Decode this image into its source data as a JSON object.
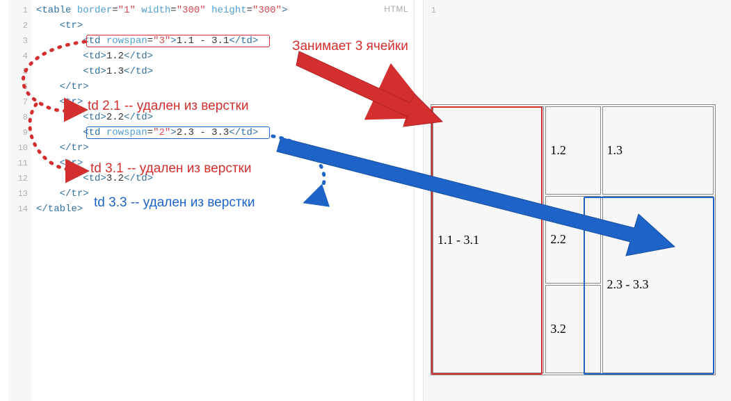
{
  "lang_badge": "HTML",
  "code": {
    "line_count": 14,
    "lines": [
      {
        "indent": 0,
        "html": "<span class='tok-tag'>&lt;table</span> <span class='tok-attr'>border</span>=<span class='tok-val'>\"1\"</span> <span class='tok-attr'>width</span>=<span class='tok-val'>\"300\"</span> <span class='tok-attr'>height</span>=<span class='tok-val'>\"300\"</span><span class='tok-tag'>&gt;</span>"
      },
      {
        "indent": 1,
        "html": "<span class='tok-tag'>&lt;tr&gt;</span>"
      },
      {
        "indent": 2,
        "html": "<span class='tok-tag'>&lt;td</span> <span class='tok-attr'>rowspan</span>=<span class='tok-val'>\"3\"</span><span class='tok-tag'>&gt;</span><span class='tok-txt'>1.1 - 3.1</span><span class='tok-tag'>&lt;/td&gt;</span>"
      },
      {
        "indent": 2,
        "html": "<span class='tok-tag'>&lt;td&gt;</span><span class='tok-txt'>1.2</span><span class='tok-tag'>&lt;/td&gt;</span>"
      },
      {
        "indent": 2,
        "html": "<span class='tok-tag'>&lt;td&gt;</span><span class='tok-txt'>1.3</span><span class='tok-tag'>&lt;/td&gt;</span>"
      },
      {
        "indent": 1,
        "html": "<span class='tok-tag'>&lt;/tr&gt;</span>"
      },
      {
        "indent": 1,
        "html": "<span class='tok-tag'>&lt;tr&gt;</span>"
      },
      {
        "indent": 2,
        "html": "<span class='tok-tag'>&lt;td&gt;</span><span class='tok-txt'>2.2</span><span class='tok-tag'>&lt;/td&gt;</span>"
      },
      {
        "indent": 2,
        "html": "<span class='tok-tag'>&lt;td</span> <span class='tok-attr'>rowspan</span>=<span class='tok-val'>\"2\"</span><span class='tok-tag'>&gt;</span><span class='tok-txt'>2.3 - 3.3</span><span class='tok-tag'>&lt;/td&gt;</span>"
      },
      {
        "indent": 1,
        "html": "<span class='tok-tag'>&lt;/tr&gt;</span>"
      },
      {
        "indent": 1,
        "html": "<span class='tok-tag'>&lt;tr&gt;</span>"
      },
      {
        "indent": 2,
        "html": "<span class='tok-tag'>&lt;td&gt;</span><span class='tok-txt'>3.2</span><span class='tok-tag'>&lt;/td&gt;</span>"
      },
      {
        "indent": 1,
        "html": "<span class='tok-tag'>&lt;/tr&gt;</span>"
      },
      {
        "indent": 0,
        "html": "<span class='tok-tag'>&lt;/table&gt;</span>"
      }
    ]
  },
  "annotations": {
    "heading": "Занимает 3 ячейки",
    "deleted_21": "td 2.1 -- удален из верстки",
    "deleted_31": "td 3.1 -- удален из верстки",
    "deleted_33": "td 3.3 -- удален из верстки"
  },
  "preview_table": {
    "rows": [
      [
        {
          "text": "1.1 - 3.1",
          "rowspan": 3
        },
        {
          "text": "1.2"
        },
        {
          "text": "1.3"
        }
      ],
      [
        {
          "text": "2.2"
        },
        {
          "text": "2.3 - 3.3",
          "rowspan": 2
        }
      ],
      [
        {
          "text": "3.2"
        }
      ]
    ]
  },
  "colors": {
    "red": "#d32f2f",
    "blue": "#1e63c8"
  }
}
